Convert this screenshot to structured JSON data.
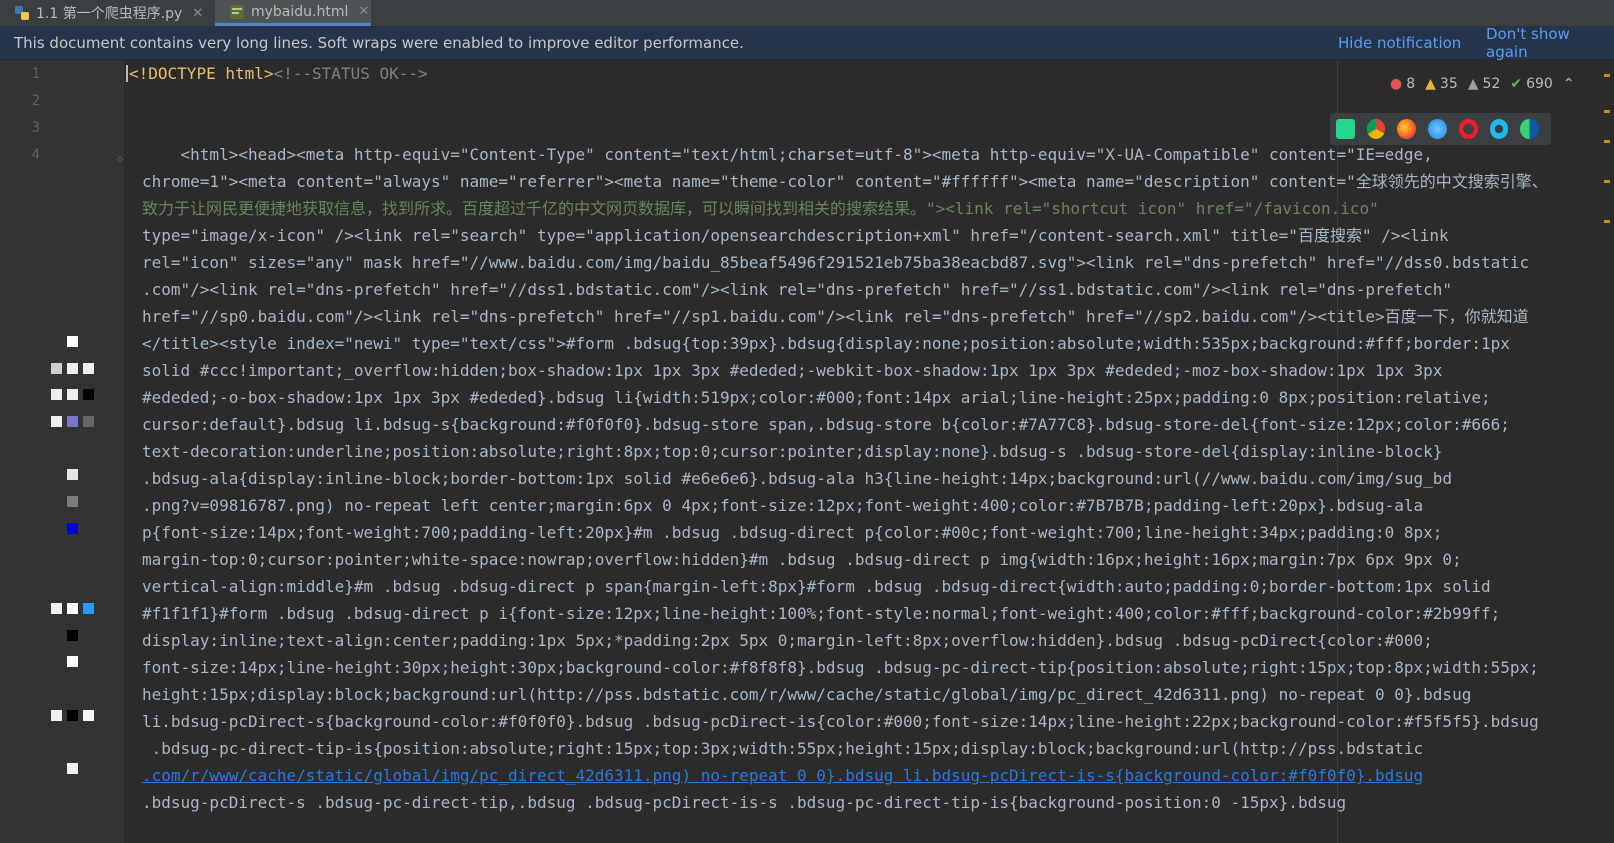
{
  "tabs": [
    {
      "label": "1.1 第一个爬虫程序.py",
      "active": false,
      "close": "✕"
    },
    {
      "label": "mybaidu.html",
      "active": true,
      "close": "✕"
    }
  ],
  "notification": {
    "message": "This document contains very long lines. Soft wraps were enabled to improve editor performance.",
    "hide": "Hide notification",
    "dont_show": "Don't show again"
  },
  "line_numbers": [
    "1",
    "2",
    "3",
    "4"
  ],
  "inspections": {
    "errors": "8",
    "warnings": "35",
    "weak_warnings": "52",
    "ok": "690"
  },
  "browser_icons": [
    "pycharm-icon",
    "chrome-icon",
    "firefox-icon",
    "safari-icon",
    "opera-icon",
    "ie-icon",
    "edge-icon"
  ],
  "code": {
    "l1_tag": "!DOCTYPE html>",
    "l1_lt": "<",
    "l1_comment": "<!--STATUS OK-->",
    "w1": "    <html><head><meta http-equiv=\"Content-Type\" content=\"text/html;charset=utf-8\"><meta http-equiv=\"X-UA-Compatible\" content=\"IE=edge,",
    "w2": "chrome=1\"><meta content=\"always\" name=\"referrer\"><meta name=\"theme-color\" content=\"#ffffff\"><meta name=\"description\" content=\"全球领先的中文搜索引擎、",
    "w3": "致力于让网民更便捷地获取信息，找到所求。百度超过千亿的中文网页数据库，可以瞬间找到相关的搜索结果。\"><link rel=\"shortcut icon\" href=\"/favicon.ico\"",
    "w4": "type=\"image/x-icon\" /><link rel=\"search\" type=\"application/opensearchdescription+xml\" href=\"/content-search.xml\" title=\"百度搜索\" /><link",
    "w5": "rel=\"icon\" sizes=\"any\" mask href=\"//www.baidu.com/img/baidu_85beaf5496f291521eb75ba38eacbd87.svg\"><link rel=\"dns-prefetch\" href=\"//dss0.bdstatic",
    "w6": ".com\"/><link rel=\"dns-prefetch\" href=\"//dss1.bdstatic.com\"/><link rel=\"dns-prefetch\" href=\"//ss1.bdstatic.com\"/><link rel=\"dns-prefetch\"",
    "w7": "href=\"//sp0.baidu.com\"/><link rel=\"dns-prefetch\" href=\"//sp1.baidu.com\"/><link rel=\"dns-prefetch\" href=\"//sp2.baidu.com\"/><title>百度一下，你就知道",
    "w8": "</title><style index=\"newi\" type=\"text/css\">#form .bdsug{top:39px}.bdsug{display:none;position:absolute;width:535px;background:#fff;border:1px",
    "w9": "solid #ccc!important;_overflow:hidden;box-shadow:1px 1px 3px #ededed;-webkit-box-shadow:1px 1px 3px #ededed;-moz-box-shadow:1px 1px 3px",
    "w10": "#ededed;-o-box-shadow:1px 1px 3px #ededed}.bdsug li{width:519px;color:#000;font:14px arial;line-height:25px;padding:0 8px;position:relative;",
    "w11": "cursor:default}.bdsug li.bdsug-s{background:#f0f0f0}.bdsug-store span,.bdsug-store b{color:#7A77C8}.bdsug-store-del{font-size:12px;color:#666;",
    "w12": "text-decoration:underline;position:absolute;right:8px;top:0;cursor:pointer;display:none}.bdsug-s .bdsug-store-del{display:inline-block}",
    "w13": ".bdsug-ala{display:inline-block;border-bottom:1px solid #e6e6e6}.bdsug-ala h3{line-height:14px;background:url(//www.baidu.com/img/sug_bd",
    "w14": ".png?v=09816787.png) no-repeat left center;margin:6px 0 4px;font-size:12px;font-weight:400;color:#7B7B7B;padding-left:20px}.bdsug-ala",
    "w15": "p{font-size:14px;font-weight:700;padding-left:20px}#m .bdsug .bdsug-direct p{color:#00c;font-weight:700;line-height:34px;padding:0 8px;",
    "w16": "margin-top:0;cursor:pointer;white-space:nowrap;overflow:hidden}#m .bdsug .bdsug-direct p img{width:16px;height:16px;margin:7px 6px 9px 0;",
    "w17": "vertical-align:middle}#m .bdsug .bdsug-direct p span{margin-left:8px}#form .bdsug .bdsug-direct{width:auto;padding:0;border-bottom:1px solid",
    "w18": "#f1f1f1}#form .bdsug .bdsug-direct p i{font-size:12px;line-height:100%;font-style:normal;font-weight:400;color:#fff;background-color:#2b99ff;",
    "w19": "display:inline;text-align:center;padding:1px 5px;*padding:2px 5px 0;margin-left:8px;overflow:hidden}.bdsug .bdsug-pcDirect{color:#000;",
    "w20": "font-size:14px;line-height:30px;height:30px;background-color:#f8f8f8}.bdsug .bdsug-pc-direct-tip{position:absolute;right:15px;top:8px;width:55px;",
    "w21": "height:15px;display:block;background:url(http://pss.bdstatic.com/r/www/cache/static/global/img/pc_direct_42d6311.png) no-repeat 0 0}.bdsug",
    "w22": "li.bdsug-pcDirect-s{background-color:#f0f0f0}.bdsug .bdsug-pcDirect-is{color:#000;font-size:14px;line-height:22px;background-color:#f5f5f5}.bdsug",
    "w23": " .bdsug-pc-direct-tip-is{position:absolute;right:15px;top:3px;width:55px;height:15px;display:block;background:url(http://pss.bdstatic",
    "w24": ".com/r/www/cache/static/global/img/pc_direct_42d6311.png) no-repeat 0 0}.bdsug li.bdsug-pcDirect-is-s{background-color:#f0f0f0}.bdsug",
    "w25": ".bdsug-pcDirect-s .bdsug-pc-direct-tip,.bdsug .bdsug-pcDirect-is-s .bdsug-pc-direct-tip-is{background-position:0 -15px}.bdsug"
  }
}
